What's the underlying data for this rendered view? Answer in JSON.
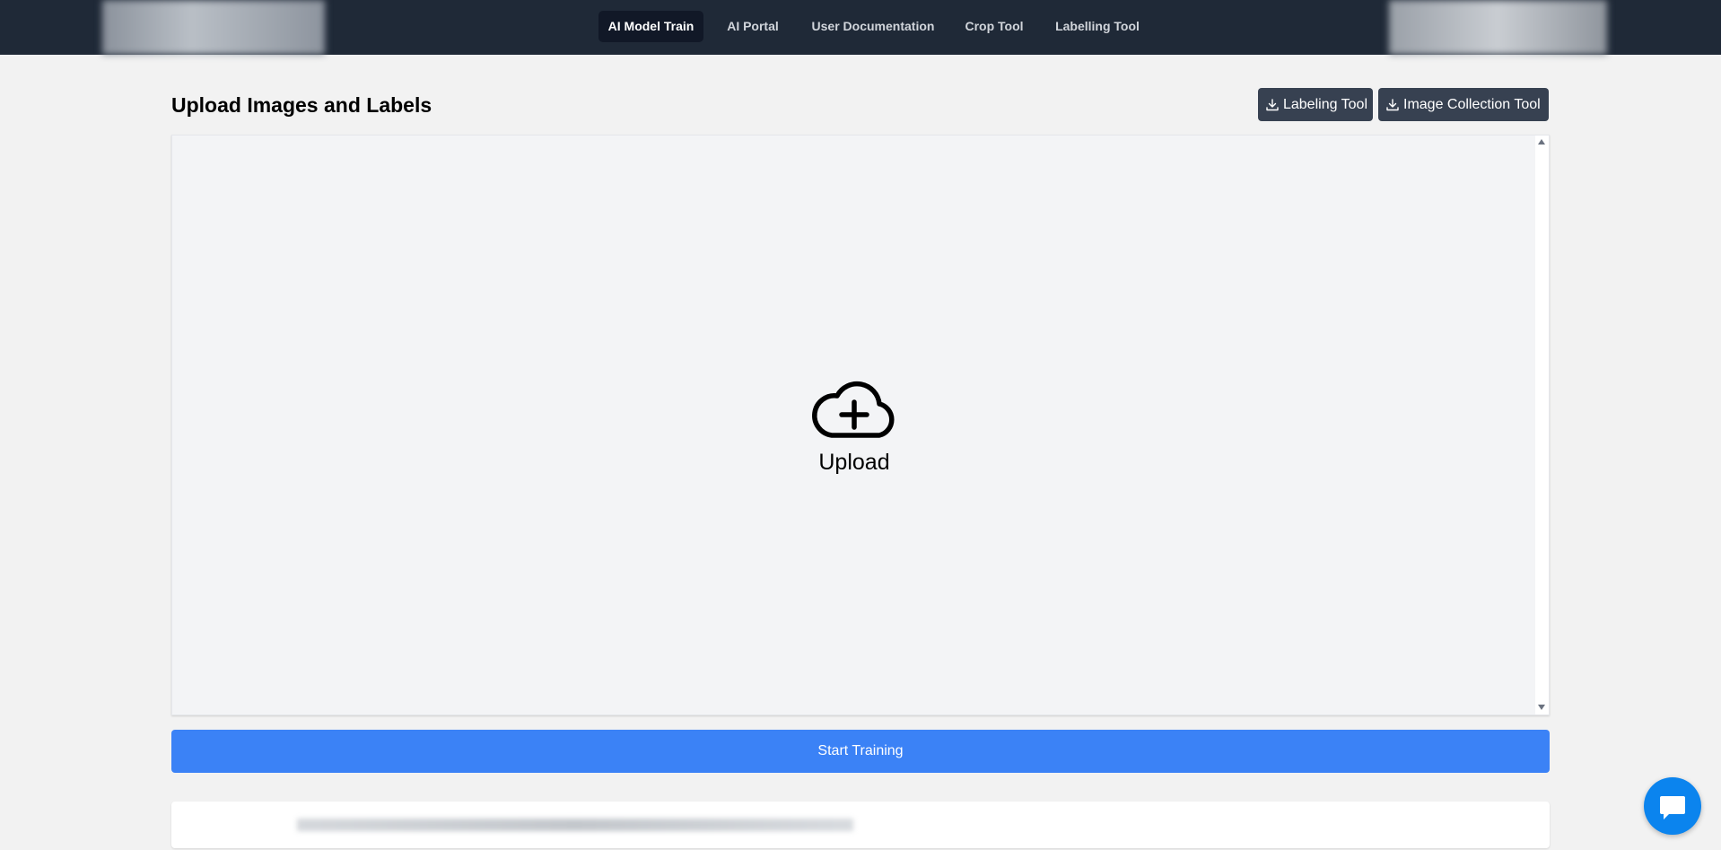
{
  "nav": {
    "items": [
      {
        "label": "AI Model Train",
        "active": true
      },
      {
        "label": "AI Portal",
        "active": false
      },
      {
        "label": "User Documentation",
        "active": false
      },
      {
        "label": "Crop Tool",
        "active": false
      },
      {
        "label": "Labelling Tool",
        "active": false
      }
    ]
  },
  "page": {
    "title": "Upload Images and Labels",
    "tool_buttons": [
      {
        "label": "Labeling Tool",
        "icon": "download-icon"
      },
      {
        "label": "Image Collection Tool",
        "icon": "download-icon"
      }
    ]
  },
  "upload": {
    "label": "Upload",
    "icon": "cloud-plus-icon"
  },
  "actions": {
    "start_training_label": "Start Training"
  },
  "chat": {
    "icon": "chat-bubble-icon"
  },
  "colors": {
    "topbar": "#1f2937",
    "active_nav": "#111827",
    "tool_button": "#374151",
    "primary": "#3b82f6",
    "chat": "#0b84ee"
  }
}
